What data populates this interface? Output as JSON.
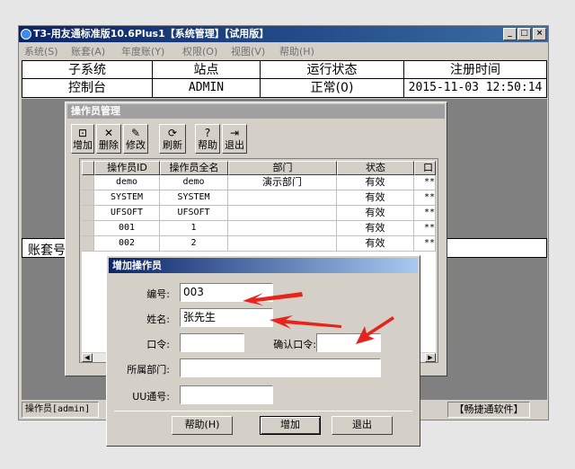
{
  "window": {
    "title": "T3-用友通标准版10.6Plus1【系统管理】【试用版】",
    "controls": [
      "_",
      "□",
      "×"
    ]
  },
  "menu": [
    "系统(S)",
    "账套(A)",
    "年度账(Y)",
    "权限(O)",
    "视图(V)",
    "帮助(H)"
  ],
  "status_table": {
    "headers": [
      "子系统",
      "站点",
      "运行状态",
      "注册时间"
    ],
    "row": [
      "控制台",
      "ADMIN",
      "正常(0)",
      "2015-11-03 12:50:14"
    ]
  },
  "account_label": "账套号",
  "statusbar": {
    "operator": "操作员[admin]",
    "brand": "【畅捷通软件】"
  },
  "op_window": {
    "title": "操作员管理",
    "toolbar": [
      {
        "icon": "add-icon",
        "glyph": "⊡",
        "label": "增加"
      },
      {
        "icon": "delete-icon",
        "glyph": "✕",
        "label": "删除"
      },
      {
        "icon": "edit-icon",
        "glyph": "✎",
        "label": "修改"
      },
      {
        "icon": "refresh-icon",
        "glyph": "⟳",
        "label": "刷新"
      },
      {
        "icon": "help-icon",
        "glyph": "?",
        "label": "帮助"
      },
      {
        "icon": "exit-icon",
        "glyph": "⇥",
        "label": "退出"
      }
    ],
    "grid": {
      "columns": [
        "操作员ID",
        "操作员全名",
        "部门",
        "状态",
        "口"
      ],
      "rows": [
        [
          "demo",
          "demo",
          "演示部门",
          "有效",
          "**"
        ],
        [
          "SYSTEM",
          "SYSTEM",
          "",
          "有效",
          "**"
        ],
        [
          "UFSOFT",
          "UFSOFT",
          "",
          "有效",
          "**"
        ],
        [
          "001",
          "1",
          "",
          "有效",
          "**"
        ],
        [
          "002",
          "2",
          "",
          "有效",
          "**"
        ]
      ]
    }
  },
  "dialog": {
    "title": "增加操作员",
    "fields": {
      "id_label": "编号:",
      "id_value": "003",
      "name_label": "姓名:",
      "name_value": "张先生",
      "password_label": "口令:",
      "password_value": "",
      "confirm_label": "确认口令:",
      "confirm_value": "",
      "dept_label": "所属部门:",
      "dept_value": "",
      "uu_label": "UU通号:",
      "uu_value": ""
    },
    "buttons": {
      "help": "帮助(H)",
      "add": "增加",
      "exit": "退出"
    }
  },
  "annotation_color": "#e8231c"
}
